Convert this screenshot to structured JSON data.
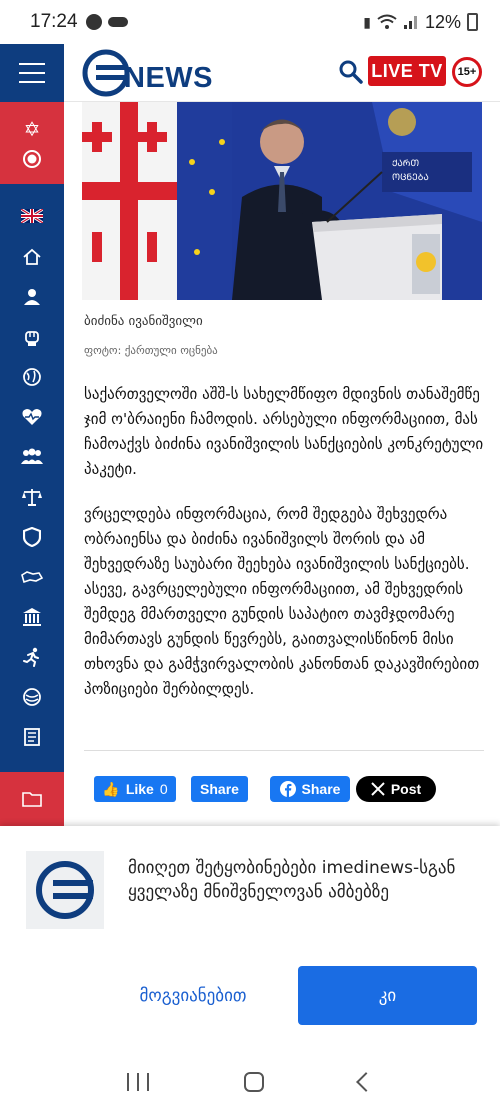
{
  "status": {
    "time": "17:24",
    "battery": "12%"
  },
  "header": {
    "logo_text": "NEWS",
    "live_label": "LIVE TV",
    "age_rating": "15+"
  },
  "sidebar": {
    "icons": [
      "star-of-david-icon",
      "record-icon",
      "uk-flag-icon",
      "home-icon",
      "person-icon",
      "fist-icon",
      "globe-icon",
      "health-icon",
      "group-icon",
      "scales-icon",
      "shield-icon",
      "map-icon",
      "institution-icon",
      "runner-icon",
      "football-icon",
      "document-icon",
      "folder-icon"
    ]
  },
  "article": {
    "caption": "ბიძინა ივანიშვილი",
    "credit": "ფოტო: ქართული ოცნება",
    "paragraph1": "საქართველოში აშშ-ს სახელმწიფო მდივნის თანაშემწე ჯიმ ო'ბრაიენი ჩამოდის. არსებული ინფორმაციით, მას ჩამოაქვს ბიძინა ივანიშვილის სანქციების კონკრეტული პაკეტი.",
    "paragraph2": "ვრცელდება ინფორმაცია, რომ შედგება შეხვედრა ობრაიენსა და ბიძინა ივანიშვილს შორის და ამ შეხვედრაზე საუბარი შეეხება ივანიშვილის სანქციებს. ასევე, გავრცელებული ინფორმაციით, ამ შეხვედრის შემდეგ მმართველი გუნდის საპატიო თავმჯდომარე მიმართავს გუნდის წევრებს, გაითვალისწინონ მისი თხოვნა და გამჭვირვალობის კანონთან დაკავშირებით პოზიციები შერბილდეს."
  },
  "share": {
    "like_label": "Like",
    "like_count": "0",
    "share_label": "Share",
    "fb_share_label": "Share",
    "x_post_label": "Post"
  },
  "notification": {
    "message": "მიიღეთ შეტყობინებები imedinews-სგან ყველაზე მნიშვნელოვან ამბებზე",
    "later_label": "მოგვიანებით",
    "ok_label": "კი"
  },
  "colors": {
    "brand_blue": "#0e3d7f",
    "accent_red": "#d6131a",
    "facebook": "#1877f2",
    "button_blue": "#1a6ce3"
  }
}
